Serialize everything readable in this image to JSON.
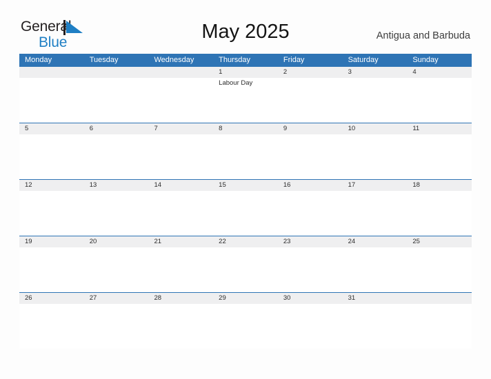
{
  "brand": {
    "word_1": "General",
    "word_2": "Blue",
    "flag_icon": "blue-pennant-flag-icon",
    "color_dark": "#231f20",
    "color_blue": "#1f7fc4"
  },
  "header": {
    "title": "May 2025",
    "country": "Antigua and Barbuda"
  },
  "theme": {
    "header_blue": "#2e74b5",
    "date_band_gray": "#efeff0",
    "page_background": "#fdfdfd",
    "text_dark": "#2b2b2b"
  },
  "calendar": {
    "weekdays": [
      "Monday",
      "Tuesday",
      "Wednesday",
      "Thursday",
      "Friday",
      "Saturday",
      "Sunday"
    ],
    "weeks": [
      {
        "days": [
          {
            "num": "",
            "events": []
          },
          {
            "num": "",
            "events": []
          },
          {
            "num": "",
            "events": []
          },
          {
            "num": "1",
            "events": [
              "Labour Day"
            ]
          },
          {
            "num": "2",
            "events": []
          },
          {
            "num": "3",
            "events": []
          },
          {
            "num": "4",
            "events": []
          }
        ]
      },
      {
        "days": [
          {
            "num": "5",
            "events": []
          },
          {
            "num": "6",
            "events": []
          },
          {
            "num": "7",
            "events": []
          },
          {
            "num": "8",
            "events": []
          },
          {
            "num": "9",
            "events": []
          },
          {
            "num": "10",
            "events": []
          },
          {
            "num": "11",
            "events": []
          }
        ]
      },
      {
        "days": [
          {
            "num": "12",
            "events": []
          },
          {
            "num": "13",
            "events": []
          },
          {
            "num": "14",
            "events": []
          },
          {
            "num": "15",
            "events": []
          },
          {
            "num": "16",
            "events": []
          },
          {
            "num": "17",
            "events": []
          },
          {
            "num": "18",
            "events": []
          }
        ]
      },
      {
        "days": [
          {
            "num": "19",
            "events": []
          },
          {
            "num": "20",
            "events": []
          },
          {
            "num": "21",
            "events": []
          },
          {
            "num": "22",
            "events": []
          },
          {
            "num": "23",
            "events": []
          },
          {
            "num": "24",
            "events": []
          },
          {
            "num": "25",
            "events": []
          }
        ]
      },
      {
        "days": [
          {
            "num": "26",
            "events": []
          },
          {
            "num": "27",
            "events": []
          },
          {
            "num": "28",
            "events": []
          },
          {
            "num": "29",
            "events": []
          },
          {
            "num": "30",
            "events": []
          },
          {
            "num": "31",
            "events": []
          },
          {
            "num": "",
            "events": []
          }
        ]
      }
    ]
  }
}
